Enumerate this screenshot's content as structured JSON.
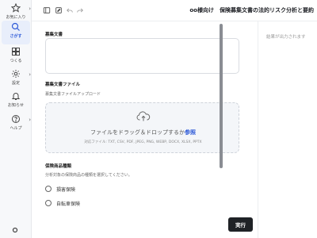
{
  "nav": {
    "items": [
      {
        "label": "お気に入り",
        "icon": "star-icon"
      },
      {
        "label": "さがす",
        "icon": "search-icon",
        "active": true
      },
      {
        "label": "つくる",
        "icon": "blocks-icon"
      },
      {
        "label": "設定",
        "icon": "gear-icon"
      },
      {
        "label": "お知らせ",
        "icon": "bell-icon"
      },
      {
        "label": "ヘルプ",
        "icon": "help-icon"
      }
    ]
  },
  "header": {
    "title": "oo様向け　保険募集文書の法的リスク分析と要約"
  },
  "form": {
    "doc_label": "募集文書",
    "file_label": "募集文書ファイル",
    "file_sub": "募集文書ファイルアップロード",
    "dropzone_text": "ファイルをドラッグ＆ドロップするか",
    "dropzone_link": "参照",
    "dropzone_types": "対応ファイル: TXT, CSV, PDF, JPEG, PNG, WEBP, DOCX, XLSX, PPTX",
    "category_label": "保険商品種類",
    "category_sub": "分析対象の保険商品の種類を選択してください。",
    "options": [
      "損害保険",
      "自転車保険"
    ],
    "run_label": "実行"
  },
  "output": {
    "placeholder": "結果が出力されます"
  },
  "colors": {
    "accent": "#2f5bd8",
    "run_button": "#1f2226"
  }
}
